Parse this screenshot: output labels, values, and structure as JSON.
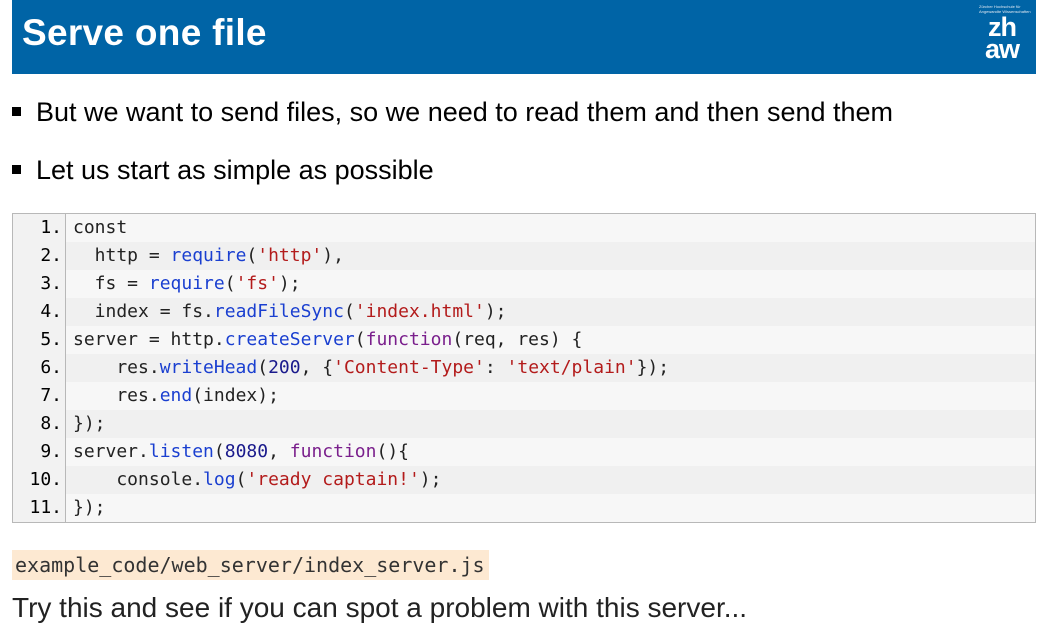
{
  "slide": {
    "title": "Serve one file",
    "logo": {
      "small_text": "Zürcher Hochschule für Angewandte Wissenschaften",
      "line1": "zh",
      "line2": "aw"
    },
    "bullets": [
      "But we want to send files, so we need to read them and then send them",
      "Let us start as simple as possible"
    ],
    "code_lines": [
      {
        "n": "1.",
        "text": "const"
      },
      {
        "n": "2.",
        "text": "  http = require('http'),"
      },
      {
        "n": "3.",
        "text": "  fs = require('fs');"
      },
      {
        "n": "4.",
        "text": "  index = fs.readFileSync('index.html');"
      },
      {
        "n": "5.",
        "text": "server = http.createServer(function(req, res) {"
      },
      {
        "n": "6.",
        "text": "    res.writeHead(200, {'Content-Type': 'text/plain'});"
      },
      {
        "n": "7.",
        "text": "    res.end(index);"
      },
      {
        "n": "8.",
        "text": "});"
      },
      {
        "n": "9.",
        "text": "server.listen(8080, function(){"
      },
      {
        "n": "10.",
        "text": "    console.log('ready captain!');"
      },
      {
        "n": "11.",
        "text": "});"
      }
    ],
    "file_path": "example_code/web_server/index_server.js",
    "note": "Try this and see if you can spot a problem with this server...",
    "colors": {
      "header": "#0064a6",
      "keyword": "#7a1f8c",
      "function": "#1a3fd0",
      "string": "#b31b1b",
      "number": "#1a1a8c",
      "path_bg": "#fde9d2"
    }
  }
}
